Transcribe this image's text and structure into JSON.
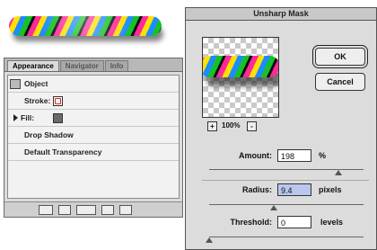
{
  "palette": {
    "tabs": [
      "Appearance",
      "Navigator",
      "Info"
    ],
    "rows": {
      "object": "Object",
      "stroke": "Stroke:",
      "fill": "Fill:",
      "drop_shadow": "Drop Shadow",
      "default_transparency": "Default Transparency"
    }
  },
  "dialog": {
    "title": "Unsharp Mask",
    "ok_label": "OK",
    "cancel_label": "Cancel",
    "zoom_level": "100%",
    "zoom_out": "-",
    "zoom_in": "+",
    "amount": {
      "label": "Amount:",
      "value": "198",
      "unit": "%"
    },
    "radius": {
      "label": "Radius:",
      "value": "9.4",
      "unit": "pixels"
    },
    "threshold": {
      "label": "Threshold:",
      "value": "0",
      "unit": "levels"
    }
  }
}
